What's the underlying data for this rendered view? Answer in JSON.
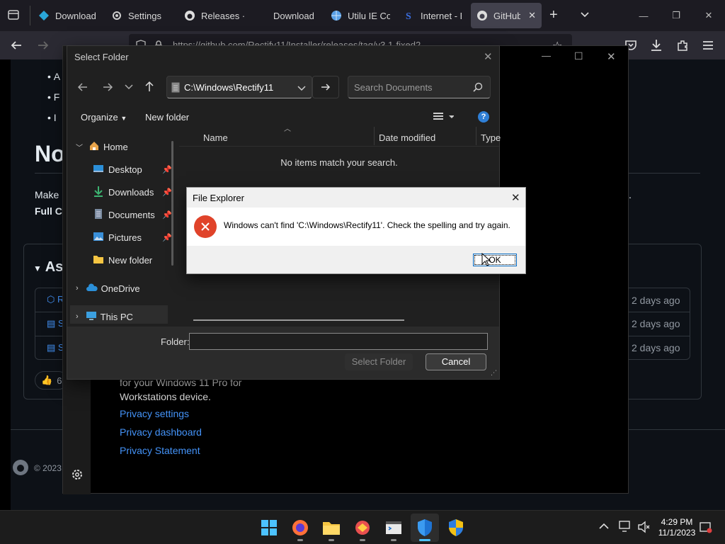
{
  "browser": {
    "tabs": [
      {
        "label": "Download",
        "icon": "diamond-logo-icon"
      },
      {
        "label": "Settings",
        "icon": "gear-icon"
      },
      {
        "label": "Releases · a",
        "icon": "github-icon"
      },
      {
        "label": "Download",
        "icon": ""
      },
      {
        "label": "Utilu IE Col",
        "icon": "globe-icon"
      },
      {
        "label": "Internet - E",
        "icon": "s-logo-icon"
      },
      {
        "label": "GitHub",
        "icon": "github-icon"
      }
    ],
    "url": "https://github.com/Rectify11/Installer/releases/tag/v3.1-fixed2"
  },
  "github_page": {
    "heading_partial": "No",
    "text_line1_partial": "Make",
    "text_line1_end": "s.",
    "text_line2_partial": "Full C",
    "assets_partial": "As",
    "asset_rows": [
      {
        "prefix": "R",
        "time": "2 days ago"
      },
      {
        "prefix": "S",
        "time": "2 days ago"
      },
      {
        "prefix": "S",
        "time": "2 days ago"
      }
    ],
    "reaction_count": "6",
    "copyright_partial": "© 2023"
  },
  "dark_window": {
    "text_line1": "for your Windows 11 Pro for",
    "text_line2": "Workstations device.",
    "links": [
      "Privacy settings",
      "Privacy dashboard",
      "Privacy Statement"
    ]
  },
  "select_folder_dialog": {
    "title": "Select Folder",
    "address": "C:\\Windows\\Rectify11",
    "search_placeholder": "Search Documents",
    "organize_label": "Organize",
    "new_folder_label": "New folder",
    "columns": [
      "Name",
      "Date modified",
      "Type"
    ],
    "empty_message": "No items match your search.",
    "sidebar": [
      {
        "label": "Home",
        "icon": "home-icon",
        "pinned": false
      },
      {
        "label": "Desktop",
        "icon": "desktop-icon",
        "pinned": true
      },
      {
        "label": "Downloads",
        "icon": "download-icon",
        "pinned": true
      },
      {
        "label": "Documents",
        "icon": "document-icon",
        "pinned": true
      },
      {
        "label": "Pictures",
        "icon": "pictures-icon",
        "pinned": true
      },
      {
        "label": "New folder",
        "icon": "folder-icon",
        "pinned": false
      },
      {
        "label": "OneDrive",
        "icon": "cloud-icon",
        "pinned": false
      },
      {
        "label": "This PC",
        "icon": "pc-icon",
        "pinned": false
      }
    ],
    "folder_label": "Folder:",
    "folder_value": "",
    "select_button": "Select Folder",
    "cancel_button": "Cancel"
  },
  "error_dialog": {
    "title": "File Explorer",
    "message": "Windows can't find 'C:\\Windows\\Rectify11'. Check the spelling and try again.",
    "ok_button": "OK"
  },
  "taskbar": {
    "time": "4:29 PM",
    "date": "11/1/2023",
    "apps": [
      "start-icon",
      "firefox-icon",
      "file-explorer-icon",
      "app-icon",
      "terminal-icon",
      "defender-icon",
      "shield-uac-icon"
    ]
  },
  "colors": {
    "accent": "#4493f8",
    "error_red": "#e0432a",
    "dialog_bg": "#202020"
  }
}
